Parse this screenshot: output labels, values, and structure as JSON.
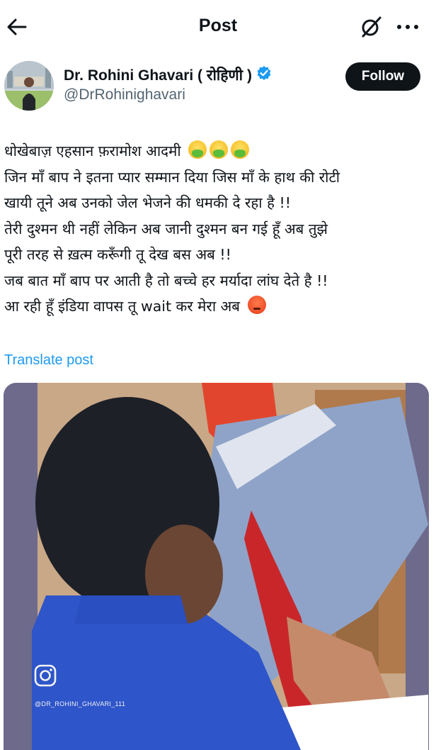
{
  "header": {
    "title": "Post",
    "back_icon": "arrow-left-icon",
    "grok_icon": "grok-icon",
    "more_icon": "more-horizontal-icon"
  },
  "author": {
    "name": "Dr. Rohini Ghavari ( रोहिणी )",
    "handle": "@DrRohinighavari",
    "verified": true,
    "verified_color": "#1d9bf0",
    "follow_label": "Follow"
  },
  "post": {
    "lines": [
      "धोखेबाज़ एहसान फ़रामोश आदमी",
      "जिन माँ बाप ने इतना प्यार सम्मान दिया जिस माँ के हाथ की रोटी",
      "खायी तूने अब उनको जेल भेजने की धमकी दे रहा है !!",
      "तेरी दुश्मन थी नहीं लेकिन अब जानी दुश्मन बन गई हूँ अब तुझे",
      "पूरी तरह से ख़त्म करूँगी तू देख बस अब !!",
      "जब बात माँ बाप पर आती है तो बच्चे हर मर्यादा लांघ देते है !!",
      "आ रही हूँ इंडिया वापस तू wait कर मेरा अब"
    ],
    "emojis": {
      "line1": [
        "nauseated-face",
        "nauseated-face",
        "nauseated-face"
      ],
      "line7": [
        "angry-face"
      ]
    },
    "translate_label": "Translate post"
  },
  "media": {
    "type": "video-still",
    "watermark": "@DR_ROHINI_GHAVARI_111",
    "watermark_icon": "instagram-icon"
  },
  "colors": {
    "accent": "#1d9bf0",
    "text": "#0f1419",
    "secondary": "#536471",
    "follow_bg": "#0f1419"
  }
}
